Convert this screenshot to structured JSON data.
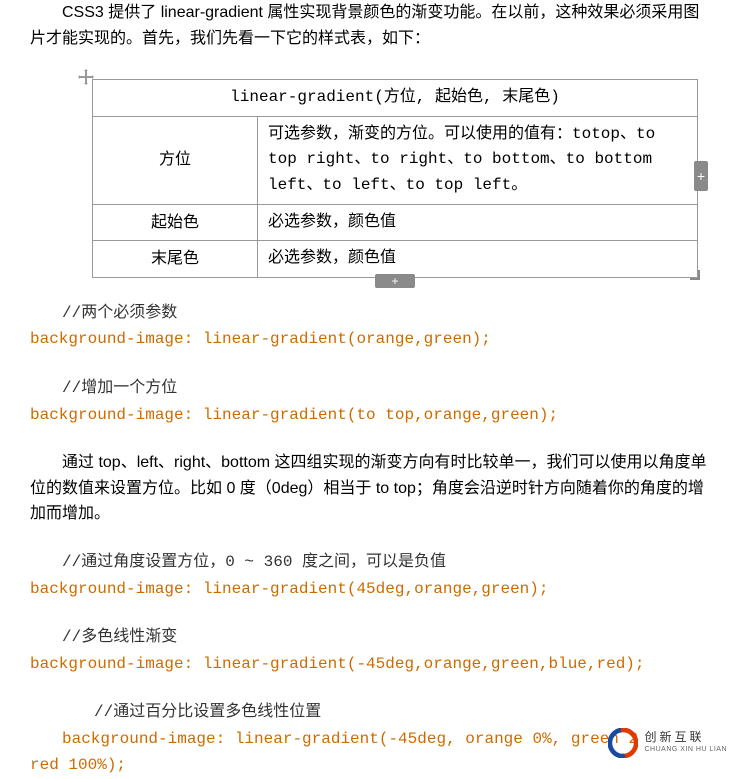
{
  "intro": "CSS3 提供了 linear-gradient 属性实现背景颜色的渐变功能。在以前，这种效果必须采用图片才能实现的。首先，我们先看一下它的样式表，如下：",
  "table": {
    "header": "linear-gradient(方位, 起始色, 末尾色)",
    "rows": [
      {
        "name": "方位",
        "desc": "可选参数，渐变的方位。可以使用的值有：totop、to top right、to right、to bottom、to bottom left、to left、to top left。"
      },
      {
        "name": "起始色",
        "desc": "必选参数，颜色值"
      },
      {
        "name": "末尾色",
        "desc": "必选参数，颜色值"
      }
    ]
  },
  "c1_comment": "//两个必须参数",
  "c1_code": "background-image: linear-gradient(orange,green);",
  "c2_comment": "//增加一个方位",
  "c2_code": "background-image: linear-gradient(to top,orange,green);",
  "para2": "通过 top、left、right、bottom 这四组实现的渐变方向有时比较单一，我们可以使用以角度单位的数值来设置方位。比如 0 度（0deg）相当于 to top；角度会沿逆时针方向随着你的角度的增加而增加。",
  "c3_comment": "//通过角度设置方位，0 ~ 360 度之间，可以是负值",
  "c3_code": "background-image: linear-gradient(45deg,orange,green);",
  "c4_comment": "//多色线性渐变",
  "c4_code": "background-image: linear-gradient(-45deg,orange,green,blue,red);",
  "c5_comment": "//通过百分比设置多色线性位置",
  "c5_code_a": "background-image: linear-gradient(-45deg, orange 0%, green 2",
  "c5_code_b": "red 100%);",
  "handles": {
    "plus": "+"
  },
  "logo": {
    "name": "创新互联",
    "sub": "CHUANG XIN HU LIAN"
  }
}
